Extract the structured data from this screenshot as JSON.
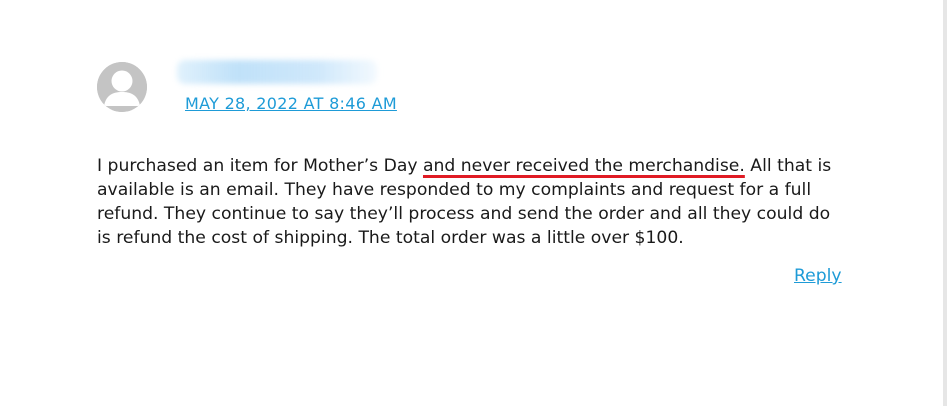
{
  "comment": {
    "author_name_obscured": "",
    "date_link": "MAY 28, 2022 AT 8:46 AM",
    "body_part1": "I purchased an item for Mother’s Day ",
    "body_highlight": "and never received the merchandise.",
    "body_part2": " All that is available is an email. They have responded to my complaints and request for a full refund. They continue to say they’ll process and send the order and all they could do is refund the cost of shipping. The total order was a little over $100.",
    "reply_label": "Reply",
    "avatar_icon": "default-user-avatar-icon"
  },
  "colors": {
    "link": "#1e9bd7",
    "highlight_underline": "#e01b24",
    "text": "#1a1a1a",
    "avatar": "#c4c4c4"
  }
}
